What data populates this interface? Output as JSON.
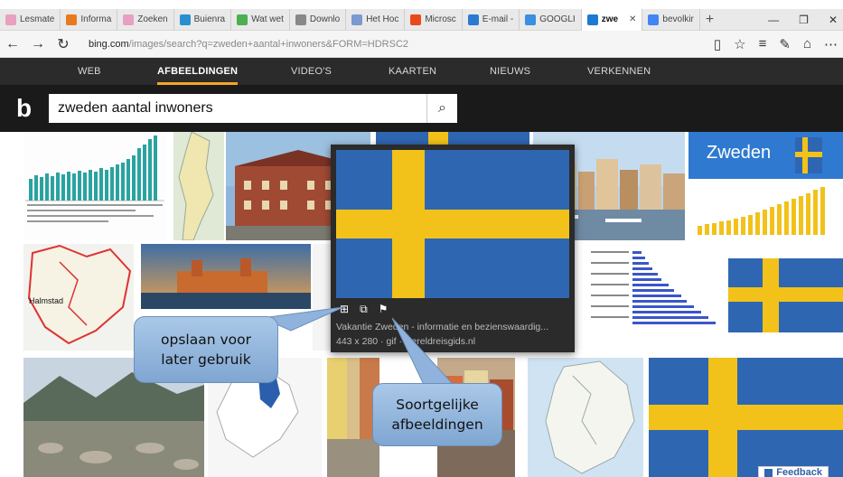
{
  "tabs": [
    {
      "label": "Lesmate",
      "color": "#e8a0c0"
    },
    {
      "label": "Informa",
      "color": "#e87a1e"
    },
    {
      "label": "Zoeken",
      "color": "#e8a0c0"
    },
    {
      "label": "Buienra",
      "color": "#2a8fd0"
    },
    {
      "label": "Wat wet",
      "color": "#4caf50"
    },
    {
      "label": "Downlo",
      "color": "#888888"
    },
    {
      "label": "Het Hoc",
      "color": "#7a9ad0"
    },
    {
      "label": "Microsc",
      "color": "#e84a1e"
    },
    {
      "label": "E-mail -",
      "color": "#2a7ad0"
    },
    {
      "label": "GOOGLI",
      "color": "#3a8fe0"
    },
    {
      "label": "zwe",
      "color": "#1e7ad0",
      "active": true
    },
    {
      "label": "bevolkir",
      "color": "#4285f4"
    }
  ],
  "address": {
    "domain": "bing.com",
    "path": "/images/search?q=zweden+aantal+inwoners&FORM=HDRSC2"
  },
  "nav": {
    "items": [
      "WEB",
      "AFBEELDINGEN",
      "VIDEO'S",
      "KAARTEN",
      "NIEUWS",
      "VERKENNEN"
    ],
    "active": "AFBEELDINGEN"
  },
  "search": {
    "query": "zweden aantal inwoners"
  },
  "popup": {
    "title": "Vakantie Zweden - informatie en bezienswaardig...",
    "meta": "443 x 280 · gif · wereldreisgids.nl"
  },
  "tiles": {
    "zweden_text": "Zweden"
  },
  "callouts": {
    "save": "opslaan voor later gebruik",
    "similar": "Soortgelijke afbeeldingen"
  },
  "feedback": "Feedback",
  "colors": {
    "swedish_blue": "#2f66b1",
    "swedish_yellow": "#f2c21a",
    "bing_nav": "#2b2b2b",
    "callout_blue": "#8fb3dc"
  }
}
